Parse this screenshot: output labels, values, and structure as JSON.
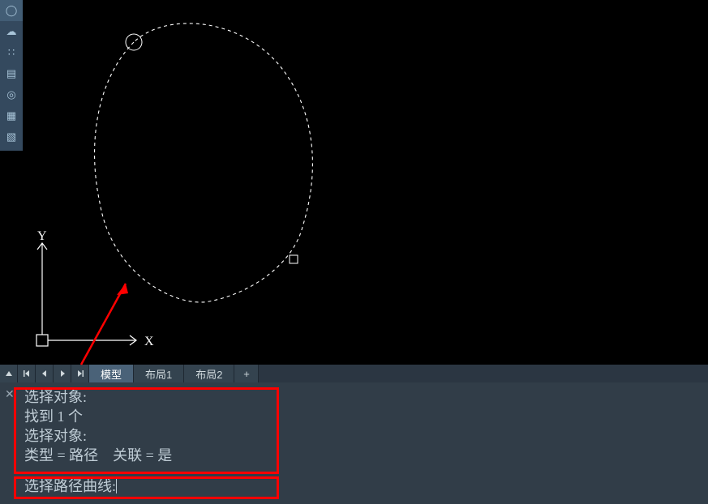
{
  "toolbar": {
    "items": [
      {
        "name": "circle-icon",
        "glyph": "◯"
      },
      {
        "name": "cloud-icon",
        "glyph": "☁"
      },
      {
        "name": "dots-icon",
        "glyph": "∷"
      },
      {
        "name": "surface-icon",
        "glyph": "▤"
      },
      {
        "name": "ring-icon",
        "glyph": "◎"
      },
      {
        "name": "grid-icon",
        "glyph": "▦"
      },
      {
        "name": "palette-icon",
        "glyph": "▧"
      }
    ]
  },
  "axes": {
    "x_label": "X",
    "y_label": "Y"
  },
  "tabs": {
    "model": "模型",
    "layout1": "布局1",
    "layout2": "布局2",
    "plus": "+"
  },
  "command": {
    "line1": "选择对象:",
    "line2": "找到 1 个",
    "line3": "选择对象:",
    "line4": "类型 = 路径    关联 = 是",
    "prompt": "选择路径曲线:",
    "input_value": ""
  }
}
